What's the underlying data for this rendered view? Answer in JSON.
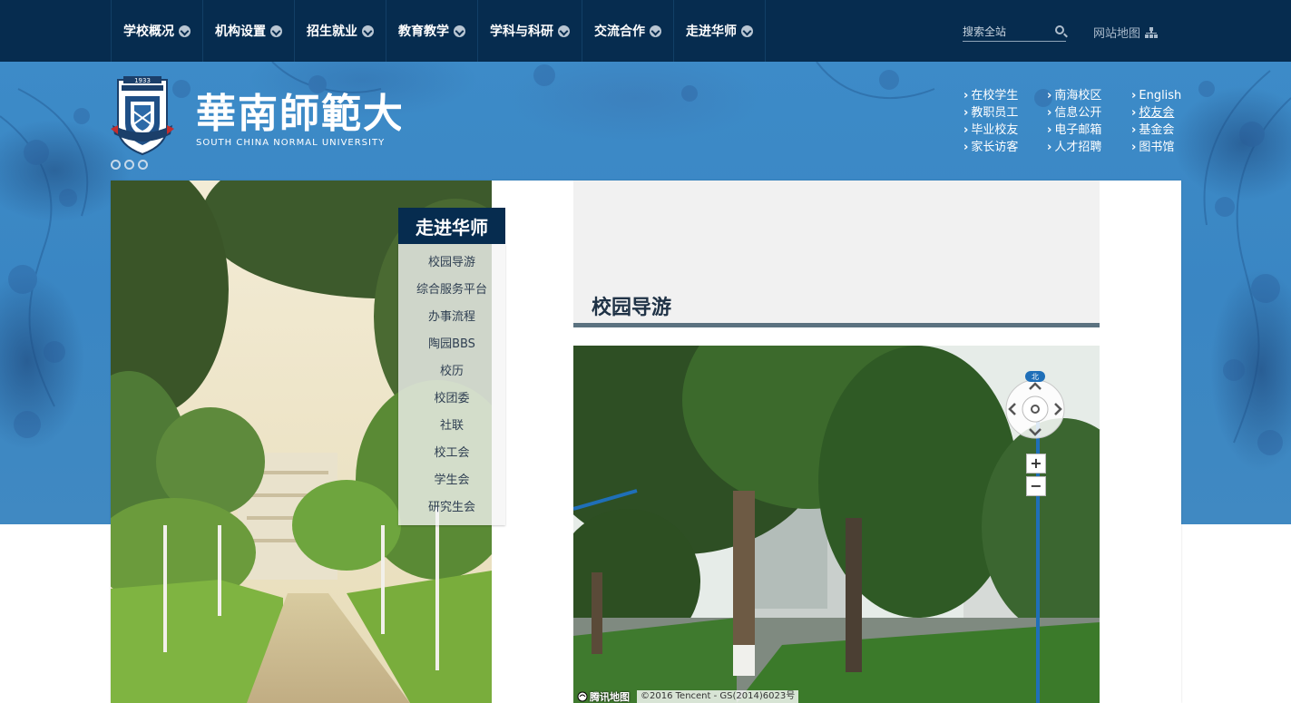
{
  "nav": {
    "items": [
      {
        "label": "学校概况"
      },
      {
        "label": "机构设置"
      },
      {
        "label": "招生就业"
      },
      {
        "label": "教育教学"
      },
      {
        "label": "学科与科研"
      },
      {
        "label": "交流合作"
      },
      {
        "label": "走进华师"
      }
    ],
    "search_placeholder": "搜索全站",
    "sitemap_label": "网站地图"
  },
  "header": {
    "logo_text_cn": "華南師範大學",
    "logo_text_en": "SOUTH CHINA NORMAL UNIVERSITY",
    "logo_year": "1933",
    "quicklinks": [
      {
        "label": "在校学生"
      },
      {
        "label": "南海校区"
      },
      {
        "label": "English"
      },
      {
        "label": "教职员工"
      },
      {
        "label": "信息公开"
      },
      {
        "label": "校友会"
      },
      {
        "label": "毕业校友"
      },
      {
        "label": "电子邮箱"
      },
      {
        "label": "基金会"
      },
      {
        "label": "家长访客"
      },
      {
        "label": "人才招聘"
      },
      {
        "label": "图书馆"
      }
    ]
  },
  "sidebar": {
    "title": "走进华师",
    "items": [
      {
        "label": "校园导游"
      },
      {
        "label": "综合服务平台"
      },
      {
        "label": "办事流程"
      },
      {
        "label": "陶园BBS"
      },
      {
        "label": "校历"
      },
      {
        "label": "校团委"
      },
      {
        "label": "社联"
      },
      {
        "label": "校工会"
      },
      {
        "label": "学生会"
      },
      {
        "label": "研究生会"
      }
    ]
  },
  "main": {
    "title": "校园导游",
    "map": {
      "compass_label": "北",
      "zoom_in": "+",
      "zoom_out": "−",
      "logo": "腾讯地图",
      "copyright": "©2016 Tencent - GS(2014)6023号"
    }
  },
  "colors": {
    "topbar": "#062c4f",
    "banner": "#3d8bc8",
    "title_underline": "#5b7280"
  }
}
